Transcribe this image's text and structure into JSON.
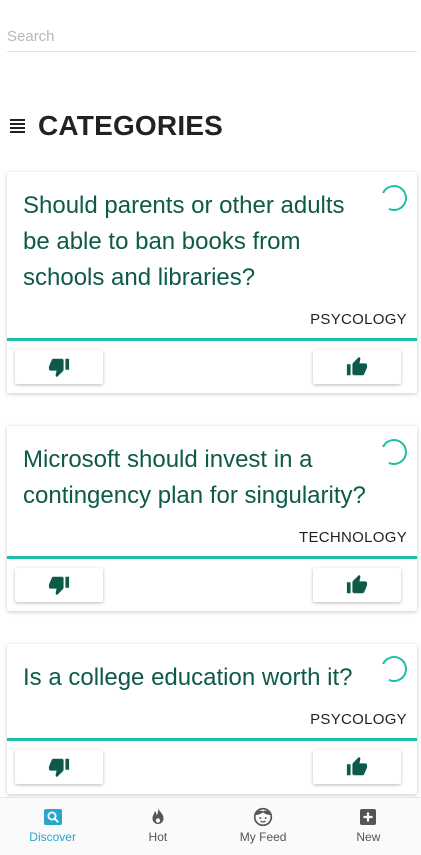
{
  "search": {
    "placeholder": "Search",
    "value": ""
  },
  "header": {
    "title": "CATEGORIES",
    "menu_icon": "hamburger-menu-icon"
  },
  "colors": {
    "accent": "#1bbfa5",
    "question_text": "#0d5a49",
    "thumb_icon": "#0d5a49",
    "tab_active": "#2aa6c8"
  },
  "cards": [
    {
      "question": "Should parents or other adults be able to ban books from schools and libraries?",
      "category": "PSYCOLOGY"
    },
    {
      "question": "Microsoft should invest in a contingency plan for singularity?",
      "category": "TECHNOLOGY"
    },
    {
      "question": "Is a college education worth it?",
      "category": "PSYCOLOGY"
    }
  ],
  "tabs": [
    {
      "label": "Discover",
      "icon": "search-icon",
      "active": true
    },
    {
      "label": "Hot",
      "icon": "flame-icon",
      "active": false
    },
    {
      "label": "My Feed",
      "icon": "face-icon",
      "active": false
    },
    {
      "label": "New",
      "icon": "plus-square-icon",
      "active": false
    }
  ]
}
